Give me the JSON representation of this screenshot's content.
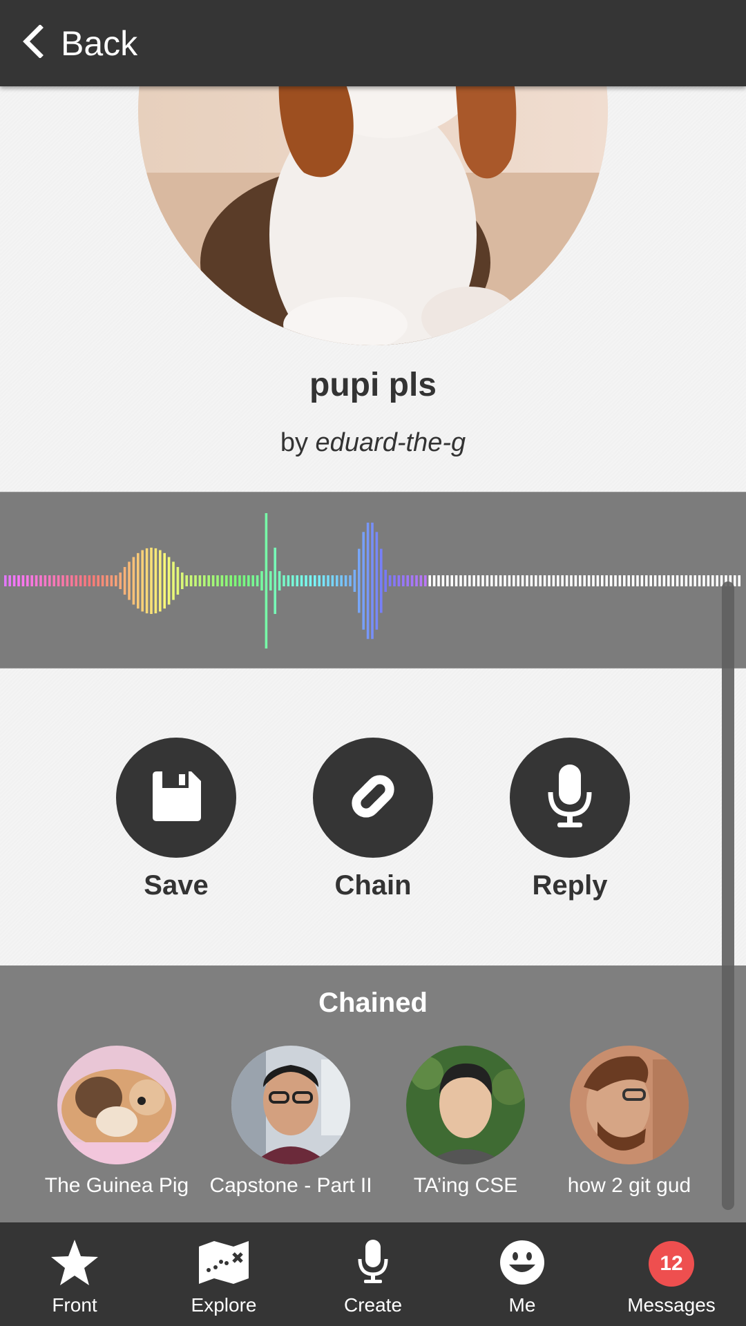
{
  "header": {
    "back_label": "Back"
  },
  "post": {
    "title": "pupi pls",
    "by_prefix": "by",
    "author": "eduard-the-g"
  },
  "actions": [
    {
      "label": "Save",
      "icon": "floppy-disk-icon"
    },
    {
      "label": "Chain",
      "icon": "link-icon"
    },
    {
      "label": "Reply",
      "icon": "microphone-icon"
    }
  ],
  "chained": {
    "title": "Chained",
    "items": [
      {
        "caption": "The Guinea Pig"
      },
      {
        "caption": "Capstone - Part II"
      },
      {
        "caption": "TA’ing CSE"
      },
      {
        "caption": "how 2 git gud"
      }
    ]
  },
  "nav": [
    {
      "label": "Front",
      "icon": "star-icon"
    },
    {
      "label": "Explore",
      "icon": "map-icon"
    },
    {
      "label": "Create",
      "icon": "microphone-icon"
    },
    {
      "label": "Me",
      "icon": "smiley-icon"
    },
    {
      "label": "Messages",
      "icon": "badge",
      "badge": "12"
    }
  ],
  "colors": {
    "dark": "#353535",
    "panel": "#7c7c7c",
    "badge": "#ee4f4f"
  }
}
